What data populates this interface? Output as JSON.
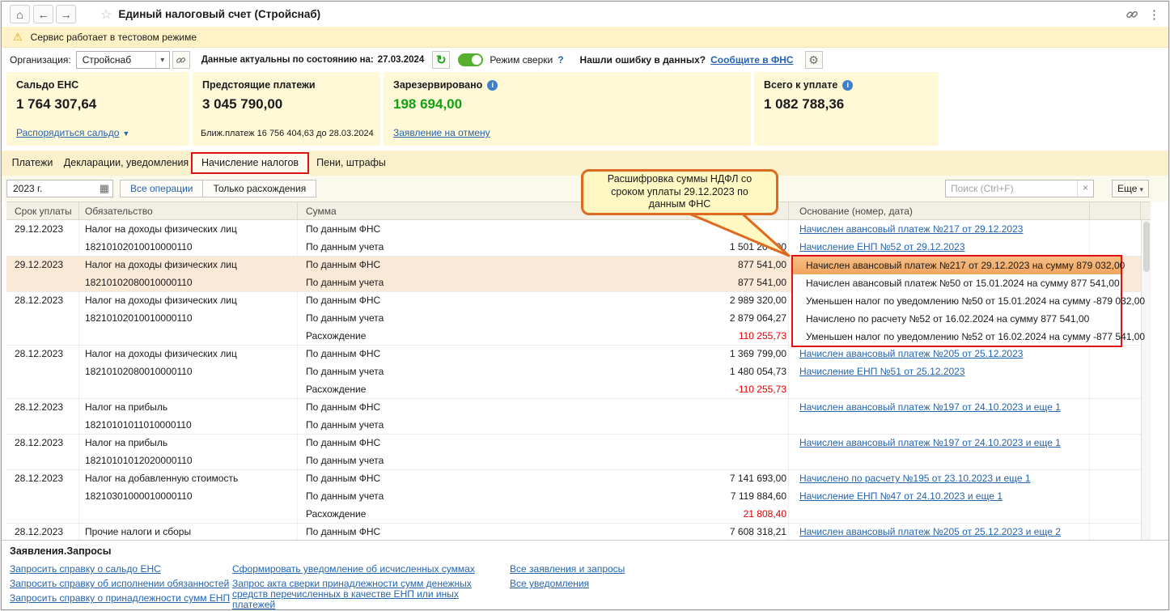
{
  "colors": {
    "panel_yellow": "#fff9d8",
    "warning_yellow": "#fff2c6",
    "highlight_orange": "#f0a55e",
    "annotation_red": "#e01212",
    "callout_border": "#dd6a1e",
    "link_blue": "#2664ae",
    "positive_green": "#12a012",
    "negative_red": "#e00000"
  },
  "icons": {
    "home": "⌂",
    "back": "←",
    "forward": "→",
    "star": "☆",
    "warning": "⚠",
    "combo_arrow": "▾",
    "refresh": "↻",
    "help": "?",
    "gear": "⚙",
    "dots": "⋮",
    "calendar": "▦",
    "clear": "×",
    "chevron_down": "▾",
    "menu_down": "▼",
    "info": "i"
  },
  "titlebar": {
    "title": "Единый налоговый счет (Стройснаб)"
  },
  "warning": {
    "text": "Сервис работает в тестовом режиме"
  },
  "toolbar": {
    "org_label": "Организация:",
    "org_value": "Стройснаб",
    "actual_label": "Данные актуальны по состоянию на:",
    "actual_date": "27.03.2024",
    "mode_label": "Режим сверки",
    "found_error": "Нашли ошибку в данных?",
    "report_link": "Сообщите в ФНС"
  },
  "cards": {
    "saldo": {
      "title": "Сальдо ЕНС",
      "value": "1 764 307,64",
      "link": "Распорядиться сальдо"
    },
    "upcoming": {
      "title": "Предстоящие платежи",
      "value": "3 045 790,00",
      "note": "Ближ.платеж 16 756 404,63 до 28.03.2024"
    },
    "reserved": {
      "title": "Зарезервировано",
      "value": "198 694,00",
      "link": "Заявление на отмену"
    },
    "total": {
      "title": "Всего к уплате",
      "value": "1 082 788,36"
    }
  },
  "tabs": {
    "payments": "Платежи",
    "declarations": "Декларации, уведомления",
    "accruals": "Начисление налогов",
    "penalties": "Пени, штрафы"
  },
  "filters": {
    "period": "2023 г.",
    "all_operations": "Все операции",
    "only_discrepancies": "Только расхождения",
    "search_placeholder": "Поиск (Ctrl+F)",
    "more": "Еще"
  },
  "table": {
    "headers": {
      "due": "Срок уплаты",
      "obligation": "Обязательство",
      "sum": "Сумма",
      "basis": "Основание (номер, дата)"
    },
    "groups": [
      {
        "due": "29.12.2023",
        "name": "Налог на доходы физических лиц",
        "kbk": "18210102010010000110",
        "lines": [
          {
            "label": "По данным ФНС",
            "amount": "",
            "basis": "Начислен авансовый платеж №217 от 29.12.2023"
          },
          {
            "label": "По данным учета",
            "amount": "1 501 204,00",
            "basis": "Начисление ЕНП №52 от 29.12.2023"
          }
        ]
      },
      {
        "due": "29.12.2023",
        "name": "Налог на доходы физических лиц",
        "kbk": "18210102080010000110",
        "lines": [
          {
            "label": "По данным ФНС",
            "amount": "877 541,00"
          },
          {
            "label": "По данным учета",
            "amount": "877 541,00"
          }
        ]
      },
      {
        "due": "28.12.2023",
        "name": "Налог на доходы физических лиц",
        "kbk": "18210102010010000110",
        "lines": [
          {
            "label": "По данным ФНС",
            "amount": "2 989 320,00"
          },
          {
            "label": "По данным учета",
            "amount": "2 879 064,27"
          },
          {
            "label": "Расхождение",
            "amount": "110 255,73"
          }
        ]
      },
      {
        "due": "28.12.2023",
        "name": "Налог на доходы физических лиц",
        "kbk": "18210102080010000110",
        "lines": [
          {
            "label": "По данным ФНС",
            "amount": "1 369 799,00",
            "basis": "Начислен авансовый платеж №205 от 25.12.2023"
          },
          {
            "label": "По данным учета",
            "amount": "1 480 054,73",
            "basis": "Начисление ЕНП №51 от 25.12.2023"
          },
          {
            "label": "Расхождение",
            "amount": "-110 255,73"
          }
        ]
      },
      {
        "due": "28.12.2023",
        "name": "Налог на прибыль",
        "kbk": "18210101011010000110",
        "lines": [
          {
            "label": "По данным ФНС",
            "amount": "",
            "basis": "Начислен авансовый платеж №197 от 24.10.2023 и еще 1"
          },
          {
            "label": "По данным учета",
            "amount": ""
          }
        ]
      },
      {
        "due": "28.12.2023",
        "name": "Налог на прибыль",
        "kbk": "18210101012020000110",
        "lines": [
          {
            "label": "По данным ФНС",
            "amount": "",
            "basis": "Начислен авансовый платеж №197 от 24.10.2023 и еще 1"
          },
          {
            "label": "По данным учета",
            "amount": ""
          }
        ]
      },
      {
        "due": "28.12.2023",
        "name": "Налог на добавленную стоимость",
        "kbk": "18210301000010000110",
        "lines": [
          {
            "label": "По данным ФНС",
            "amount": "7 141 693,00",
            "basis": "Начислено по расчету №195 от 23.10.2023 и еще 1"
          },
          {
            "label": "По данным учета",
            "amount": "7 119 884,60",
            "basis": "Начисление ЕНП №47 от 24.10.2023 и еще 1"
          },
          {
            "label": "Расхождение",
            "amount": "21 808,40"
          }
        ]
      },
      {
        "due": "28.12.2023",
        "name": "Прочие налоги и сборы",
        "kbk": "",
        "lines": [
          {
            "label": "По данным ФНС",
            "amount": "7 608 318,21",
            "basis": "Начислен авансовый платеж №205 от 25.12.2023 и еще 2"
          }
        ]
      }
    ]
  },
  "popup": {
    "lines": [
      "Начислен авансовый платеж №217 от 29.12.2023 на сумму 879 032,00",
      "Начислен авансовый платеж №50 от 15.01.2024 на сумму 877 541,00",
      "Уменьшен налог по уведомлению №50 от 15.01.2024 на сумму -879 032,00",
      "Начислено по расчету №52 от 16.02.2024 на сумму 877 541,00",
      "Уменьшен налог по уведомлению №52 от 16.02.2024 на сумму -877 541,00"
    ]
  },
  "callout": {
    "line1": "Расшифровка суммы НДФЛ со",
    "line2": "сроком уплаты 29.12.2023 по",
    "line3": "данным ФНС"
  },
  "footer": {
    "title": "Заявления.Запросы",
    "links1": [
      "Запросить справку о сальдо ЕНС",
      "Запросить справку об исполнении обязанностей",
      "Запросить справку о принадлежности сумм ЕНП"
    ],
    "links2": [
      "Сформировать уведомление об исчисленных суммах",
      "Запрос акта сверки принадлежности сумм денежных средств перечисленных в качестве ЕНП или иных платежей"
    ],
    "links3": [
      "Все заявления и запросы",
      "Все уведомления"
    ]
  }
}
